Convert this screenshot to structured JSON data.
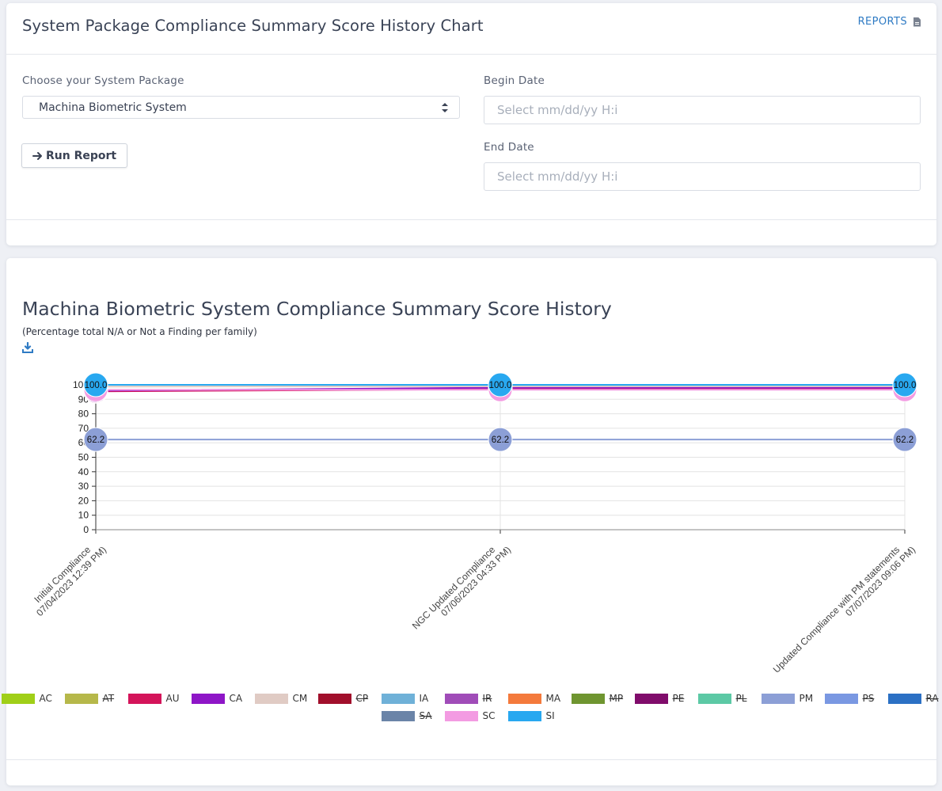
{
  "header": {
    "title": "System Package Compliance Summary Score History Chart",
    "reports_label": "REPORTS"
  },
  "form": {
    "system_package_label": "Choose your System Package",
    "system_package_value": "Machina Biometric System",
    "run_report_label": "Run Report",
    "begin_date_label": "Begin Date",
    "begin_date_placeholder": "Select mm/dd/yy H:i",
    "end_date_label": "End Date",
    "end_date_placeholder": "Select mm/dd/yy H:i"
  },
  "chart_data": {
    "type": "line",
    "title": "Machina Biometric System Compliance Summary Score History",
    "subtitle": "(Percentage total N/A or Not a Finding per family)",
    "x": [
      [
        "Initial Compliance",
        "07/04/2023 12:39 PM)"
      ],
      [
        "NGC Updated Compliance",
        "07/06/2023 04:33 PM)"
      ],
      [
        "Updated Compliance with PM statements",
        "07/07/2023 09:06 PM)"
      ]
    ],
    "ylim": [
      0,
      100
    ],
    "yticks": [
      0,
      10,
      20,
      30,
      40,
      50,
      60,
      70,
      80,
      90,
      100
    ],
    "series": [
      {
        "name": "AC",
        "color": "#a0cf18",
        "visible": true,
        "values": [
          100.0,
          100.0,
          100.0
        ]
      },
      {
        "name": "AT",
        "color": "#b6b84a",
        "visible": false,
        "values": [
          100.0,
          100.0,
          100.0
        ]
      },
      {
        "name": "AU",
        "color": "#d4145a",
        "visible": true,
        "values": [
          95.5,
          97.0,
          97.0
        ]
      },
      {
        "name": "CA",
        "color": "#8e16c7",
        "visible": true,
        "values": [
          96.0,
          98.0,
          98.0
        ]
      },
      {
        "name": "CM",
        "color": "#e0cbc4",
        "visible": true,
        "values": [
          98.8,
          99.0,
          99.0
        ]
      },
      {
        "name": "CP",
        "color": "#a10f2b",
        "visible": false,
        "values": [
          100.0,
          100.0,
          100.0
        ]
      },
      {
        "name": "IA",
        "color": "#6fb1d8",
        "visible": true,
        "values": [
          100.0,
          100.0,
          100.0
        ]
      },
      {
        "name": "IR",
        "color": "#a04cb8",
        "visible": false,
        "values": [
          100.0,
          100.0,
          100.0
        ]
      },
      {
        "name": "MA",
        "color": "#f47a3c",
        "visible": true,
        "values": [
          100.0,
          100.0,
          100.0
        ]
      },
      {
        "name": "MP",
        "color": "#6f9530",
        "visible": false,
        "values": [
          100.0,
          100.0,
          100.0
        ]
      },
      {
        "name": "PE",
        "color": "#800c6b",
        "visible": false,
        "values": [
          100.0,
          100.0,
          100.0
        ]
      },
      {
        "name": "PL",
        "color": "#5cc9a5",
        "visible": false,
        "values": [
          100.0,
          100.0,
          100.0
        ]
      },
      {
        "name": "PM",
        "color": "#8c9fd6",
        "visible": true,
        "values": [
          62.2,
          62.2,
          62.2
        ]
      },
      {
        "name": "PS",
        "color": "#7a98e2",
        "visible": false,
        "values": [
          100.0,
          100.0,
          100.0
        ]
      },
      {
        "name": "RA",
        "color": "#2b70c4",
        "visible": false,
        "values": [
          100.0,
          100.0,
          100.0
        ]
      },
      {
        "name": "SA",
        "color": "#6b84a8",
        "visible": false,
        "values": [
          100.0,
          100.0,
          100.0
        ]
      },
      {
        "name": "SC",
        "color": "#f39be2",
        "visible": true,
        "values": [
          96.6,
          96.6,
          96.6
        ]
      },
      {
        "name": "SI",
        "color": "#28a8f0",
        "visible": true,
        "values": [
          100.0,
          100.0,
          100.0
        ]
      }
    ]
  }
}
